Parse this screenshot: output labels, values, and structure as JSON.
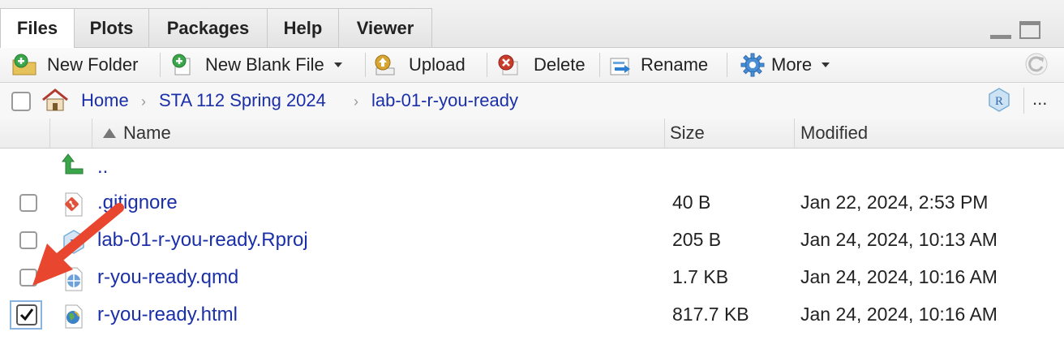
{
  "tabs": [
    {
      "label": "Files"
    },
    {
      "label": "Plots"
    },
    {
      "label": "Packages"
    },
    {
      "label": "Help"
    },
    {
      "label": "Viewer"
    }
  ],
  "toolbar": {
    "new_folder": "New Folder",
    "new_blank_file": "New Blank File",
    "upload": "Upload",
    "delete": "Delete",
    "rename": "Rename",
    "more": "More"
  },
  "breadcrumb": {
    "items": [
      "Home",
      "STA 112 Spring 2024",
      "lab-01-r-you-ready"
    ],
    "more_label": "..."
  },
  "columns": {
    "name": "Name",
    "size": "Size",
    "modified": "Modified"
  },
  "parent_dir": "..",
  "files": [
    {
      "name": ".gitignore",
      "size": "40 B",
      "modified": "Jan 22, 2024, 2:53 PM",
      "icon": "git-file-icon",
      "checked": false
    },
    {
      "name": "lab-01-r-you-ready.Rproj",
      "size": "205 B",
      "modified": "Jan 24, 2024, 10:13 AM",
      "icon": "rproj-file-icon",
      "checked": false
    },
    {
      "name": "r-you-ready.qmd",
      "size": "1.7 KB",
      "modified": "Jan 24, 2024, 10:16 AM",
      "icon": "quarto-file-icon",
      "checked": false
    },
    {
      "name": "r-you-ready.html",
      "size": "817.7 KB",
      "modified": "Jan 24, 2024, 10:16 AM",
      "icon": "html-file-icon",
      "checked": true
    }
  ],
  "colors": {
    "link": "#1a2fa8",
    "annotation_arrow": "#e8462e"
  }
}
